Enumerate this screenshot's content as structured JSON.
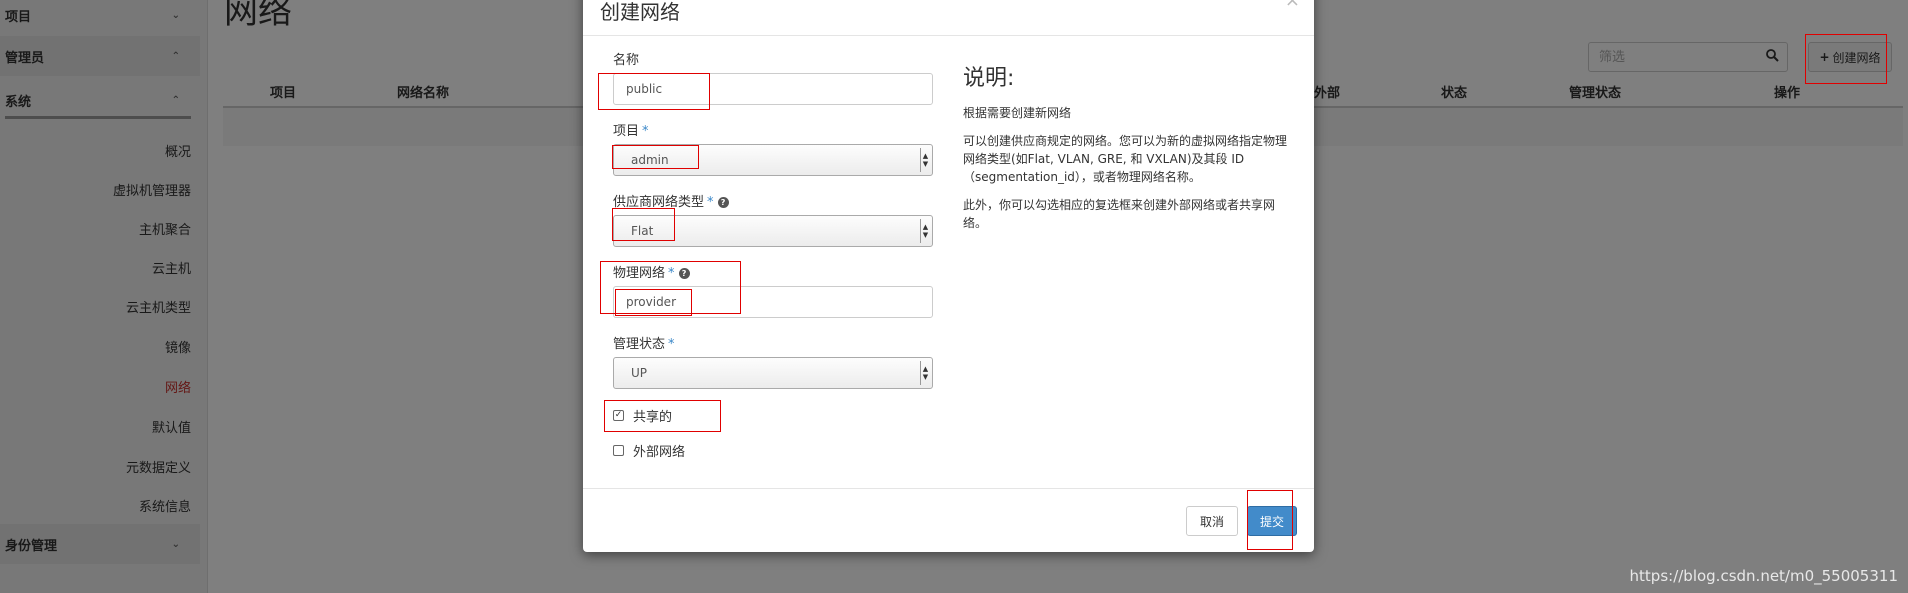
{
  "sidebar": {
    "project_label": "项目",
    "admin_label": "管理员",
    "system_label": "系统",
    "items": [
      "概况",
      "虚拟机管理器",
      "主机聚合",
      "云主机",
      "云主机类型",
      "镜像",
      "网络",
      "默认值",
      "元数据定义",
      "系统信息"
    ],
    "identity_label": "身份管理",
    "active_item": "网络"
  },
  "page": {
    "title": "网络",
    "filter_placeholder": "筛选",
    "create_button": "创建网络",
    "columns": [
      "项目",
      "网络名称",
      "外部",
      "状态",
      "管理状态",
      "操作"
    ]
  },
  "modal": {
    "title": "创建网络",
    "close": "×",
    "name_label": "名称",
    "name_value": "public",
    "project_label": "项目",
    "project_value": "admin",
    "provider_type_label": "供应商网络类型",
    "provider_type_value": "Flat",
    "physical_network_label": "物理网络",
    "physical_network_value": "provider",
    "admin_state_label": "管理状态",
    "admin_state_value": "UP",
    "shared_label": "共享的",
    "shared_checked": true,
    "external_label": "外部网络",
    "external_checked": false,
    "required_mark": "*",
    "help_mark": "?",
    "description_title": "说明:",
    "description_p1": "根据需要创建新网络",
    "description_p2": "可以创建供应商规定的网络。您可以为新的虚拟网络指定物理网络类型(如Flat, VLAN, GRE, 和 VXLAN)及其段 ID（segmentation_id），或者物理网络名称。",
    "description_p3": "此外，你可以勾选相应的复选框来创建外部网络或者共享网络。",
    "cancel_button": "取消",
    "submit_button": "提交"
  },
  "watermark": "https://blog.csdn.net/m0_55005311",
  "colors": {
    "primary": "#428bca",
    "active_nav": "#c9302c",
    "annotation": "#e00000",
    "required": "#3a87c8"
  }
}
